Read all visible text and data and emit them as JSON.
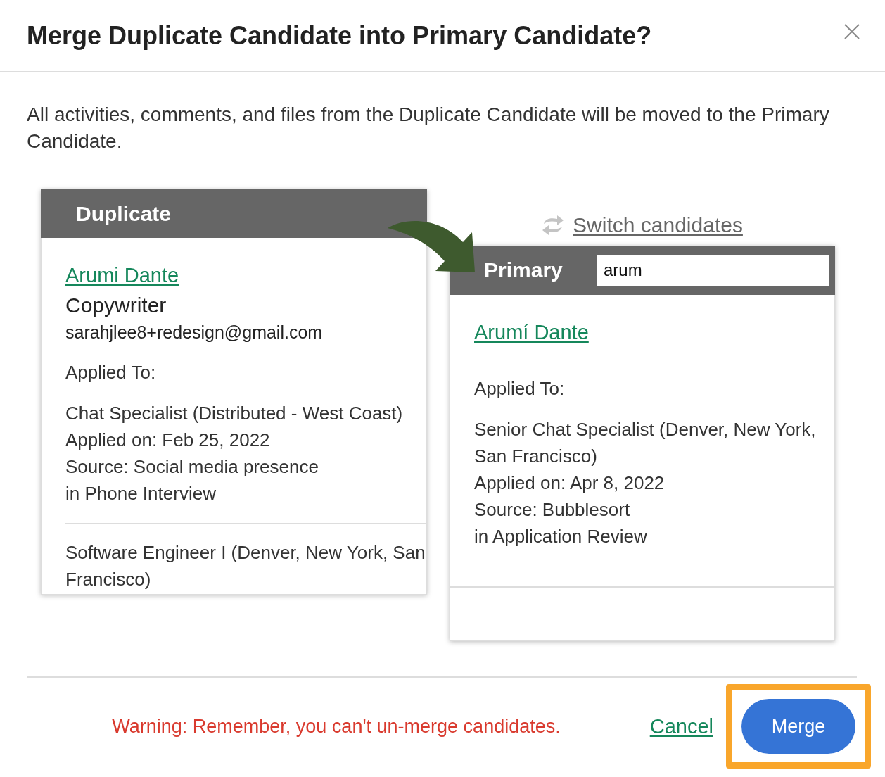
{
  "dialog": {
    "title": "Merge Duplicate Candidate into Primary Candidate?"
  },
  "description": "All activities, comments, and files from the Duplicate Candidate will be moved to the Primary Candidate.",
  "duplicate": {
    "heading": "Duplicate",
    "name": "Arumi Dante",
    "role": "Copywriter",
    "email": "sarahjlee8+redesign@gmail.com",
    "applied_label": "Applied To:",
    "applications": [
      {
        "job": "Chat Specialist (Distributed - West Coast)",
        "applied_on": "Applied on: Feb 25, 2022",
        "source": "Source: Social media presence",
        "stage": "in Phone Interview"
      },
      {
        "job": "Software Engineer I (Denver, New York, San Francisco)"
      }
    ]
  },
  "switch_link": "Switch candidates",
  "primary": {
    "heading": "Primary",
    "search": {
      "value": "arum"
    },
    "name": "Arumí Dante",
    "applied_label": "Applied To:",
    "applications": [
      {
        "job": "Senior Chat Specialist (Denver, New York, San Francisco)",
        "applied_on": "Applied on: Apr 8, 2022",
        "source": "Source: Bubblesort",
        "stage": "in Application Review"
      }
    ]
  },
  "footer": {
    "warning": "Warning: Remember, you can't un-merge candidates.",
    "cancel": "Cancel",
    "merge": {
      "label": "Merge",
      "highlighted": true
    }
  }
}
